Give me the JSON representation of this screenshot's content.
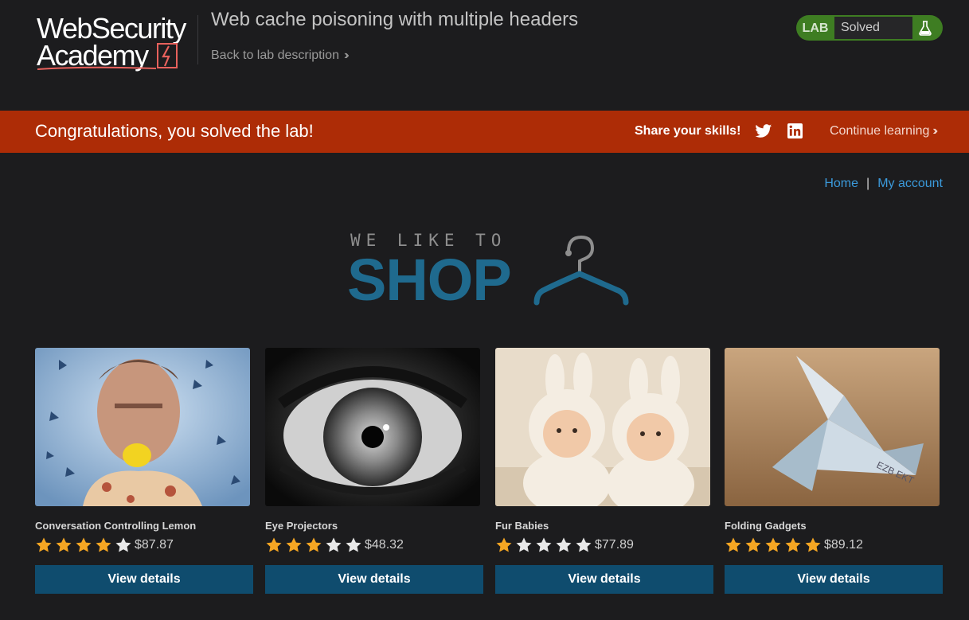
{
  "header": {
    "logo_line1": "WebSecurity",
    "logo_line2": "Academy",
    "lab_title": "Web cache poisoning with multiple headers",
    "back_link": "Back to lab description",
    "status_label": "LAB",
    "status_value": "Solved"
  },
  "banner": {
    "message": "Congratulations, you solved the lab!",
    "share_label": "Share your skills!",
    "continue_label": "Continue learning"
  },
  "nav": {
    "home": "Home",
    "separator": "|",
    "account": "My account"
  },
  "shop_logo": {
    "top_text": "WE LIKE TO",
    "main_text": "SHOP"
  },
  "products": [
    {
      "name": "Conversation Controlling Lemon",
      "rating": 4,
      "price": "$87.87",
      "button": "View details",
      "image": "man-biting-lemon"
    },
    {
      "name": "Eye Projectors",
      "rating": 3,
      "price": "$48.32",
      "button": "View details",
      "image": "close-up-eye"
    },
    {
      "name": "Fur Babies",
      "rating": 1,
      "price": "$77.89",
      "button": "View details",
      "image": "babies-in-bunny-hats"
    },
    {
      "name": "Folding Gadgets",
      "rating": 5,
      "price": "$89.12",
      "button": "View details",
      "image": "origami-banknote"
    }
  ],
  "colors": {
    "banner": "#ad2c06",
    "status_green": "#3e7d22",
    "button": "#0f4c6e",
    "link": "#3b9adb",
    "star_filled": "#f5a623",
    "star_empty": "#e8e8e8"
  }
}
